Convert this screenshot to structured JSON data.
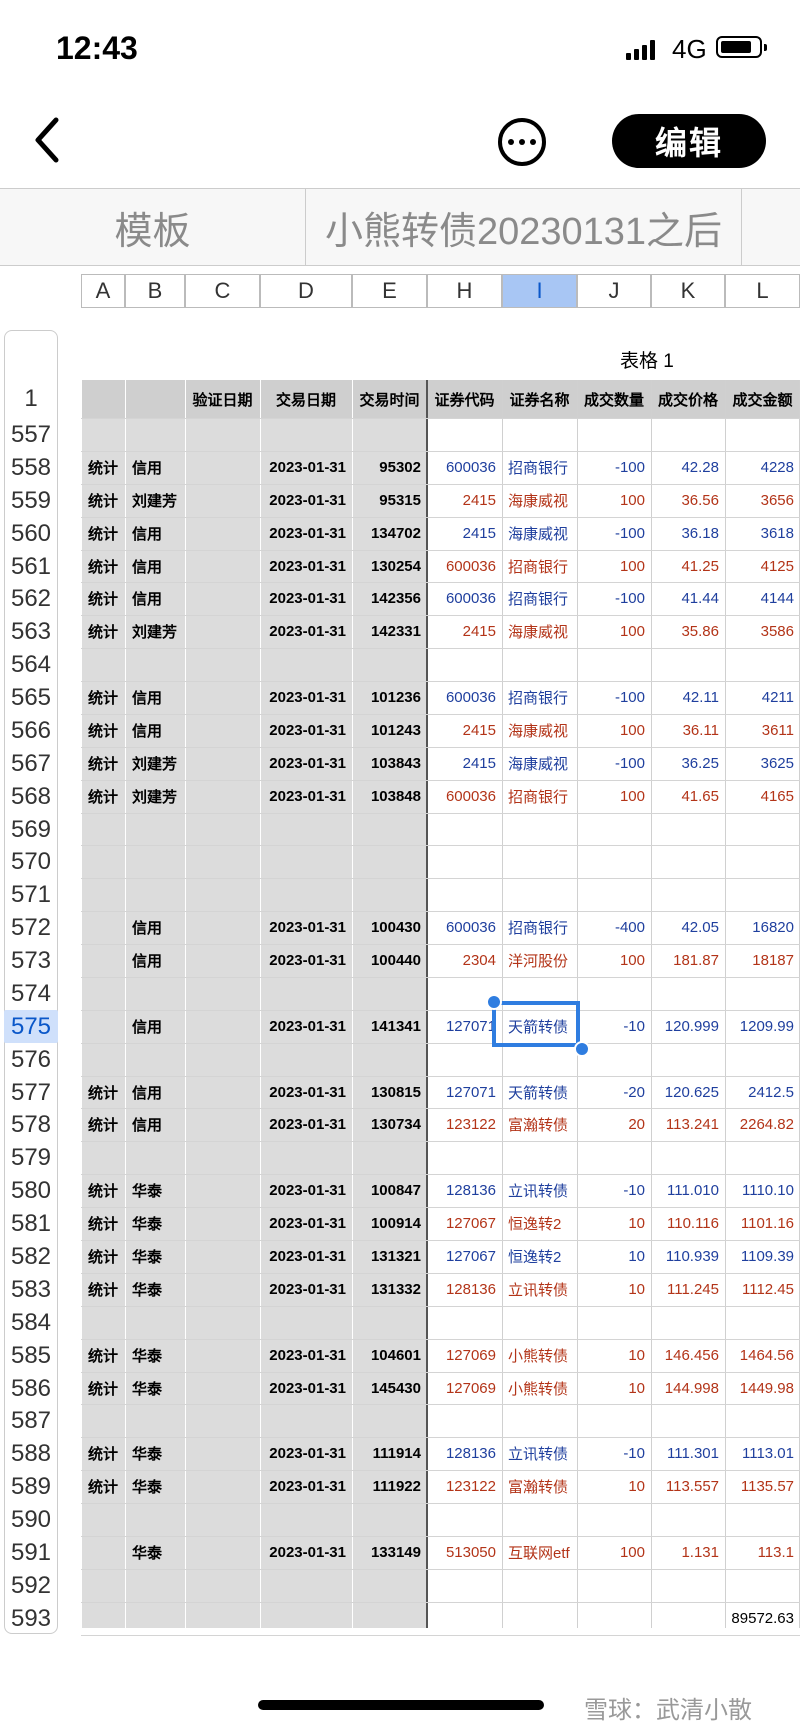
{
  "status_bar": {
    "time": "12:43",
    "network": "4G"
  },
  "toolbar": {
    "edit_label": "编辑"
  },
  "sheet_tabs": [
    {
      "label": "模板"
    },
    {
      "label": "小熊转债20230131之后"
    }
  ],
  "column_letters": [
    "A",
    "B",
    "C",
    "D",
    "E",
    "H",
    "I",
    "J",
    "K",
    "L"
  ],
  "selected_column": "I",
  "table_title": "表格 1",
  "header_row_number": "1",
  "headers": {
    "C": "验证日期",
    "D": "交易日期",
    "E": "交易时间",
    "H": "证券代码",
    "I": "证券名称",
    "J": "成交数量",
    "K": "成交价格",
    "L": "成交金额"
  },
  "rows": [
    {
      "n": "557"
    },
    {
      "n": "558",
      "a": "统计",
      "b": "信用",
      "d": "2023-01-31",
      "e": "95302",
      "h": "600036",
      "i": "招商银行",
      "j": "-100",
      "k": "42.28",
      "l": "4228",
      "color": "blue"
    },
    {
      "n": "559",
      "a": "统计",
      "b": "刘建芳",
      "d": "2023-01-31",
      "e": "95315",
      "h": "2415",
      "i": "海康威视",
      "j": "100",
      "k": "36.56",
      "l": "3656",
      "color": "red"
    },
    {
      "n": "560",
      "a": "统计",
      "b": "信用",
      "d": "2023-01-31",
      "e": "134702",
      "h": "2415",
      "i": "海康威视",
      "j": "-100",
      "k": "36.18",
      "l": "3618",
      "color": "blue"
    },
    {
      "n": "561",
      "a": "统计",
      "b": "信用",
      "d": "2023-01-31",
      "e": "130254",
      "h": "600036",
      "i": "招商银行",
      "j": "100",
      "k": "41.25",
      "l": "4125",
      "color": "red"
    },
    {
      "n": "562",
      "a": "统计",
      "b": "信用",
      "d": "2023-01-31",
      "e": "142356",
      "h": "600036",
      "i": "招商银行",
      "j": "-100",
      "k": "41.44",
      "l": "4144",
      "color": "blue"
    },
    {
      "n": "563",
      "a": "统计",
      "b": "刘建芳",
      "d": "2023-01-31",
      "e": "142331",
      "h": "2415",
      "i": "海康威视",
      "j": "100",
      "k": "35.86",
      "l": "3586",
      "color": "red"
    },
    {
      "n": "564"
    },
    {
      "n": "565",
      "a": "统计",
      "b": "信用",
      "d": "2023-01-31",
      "e": "101236",
      "h": "600036",
      "i": "招商银行",
      "j": "-100",
      "k": "42.11",
      "l": "4211",
      "color": "blue"
    },
    {
      "n": "566",
      "a": "统计",
      "b": "信用",
      "d": "2023-01-31",
      "e": "101243",
      "h": "2415",
      "i": "海康威视",
      "j": "100",
      "k": "36.11",
      "l": "3611",
      "color": "red"
    },
    {
      "n": "567",
      "a": "统计",
      "b": "刘建芳",
      "d": "2023-01-31",
      "e": "103843",
      "h": "2415",
      "i": "海康威视",
      "j": "-100",
      "k": "36.25",
      "l": "3625",
      "color": "blue"
    },
    {
      "n": "568",
      "a": "统计",
      "b": "刘建芳",
      "d": "2023-01-31",
      "e": "103848",
      "h": "600036",
      "i": "招商银行",
      "j": "100",
      "k": "41.65",
      "l": "4165",
      "color": "red"
    },
    {
      "n": "569"
    },
    {
      "n": "570"
    },
    {
      "n": "571"
    },
    {
      "n": "572",
      "b": "信用",
      "d": "2023-01-31",
      "e": "100430",
      "h": "600036",
      "i": "招商银行",
      "j": "-400",
      "k": "42.05",
      "l": "16820",
      "color": "blue"
    },
    {
      "n": "573",
      "b": "信用",
      "d": "2023-01-31",
      "e": "100440",
      "h": "2304",
      "i": "洋河股份",
      "j": "100",
      "k": "181.87",
      "l": "18187",
      "color": "red"
    },
    {
      "n": "574"
    },
    {
      "n": "575",
      "b": "信用",
      "d": "2023-01-31",
      "e": "141341",
      "h": "127071",
      "i": "天箭转债",
      "j": "-10",
      "k": "120.999",
      "l": "1209.99",
      "color": "blue",
      "selected": true
    },
    {
      "n": "576"
    },
    {
      "n": "577",
      "a": "统计",
      "b": "信用",
      "d": "2023-01-31",
      "e": "130815",
      "h": "127071",
      "i": "天箭转债",
      "j": "-20",
      "k": "120.625",
      "l": "2412.5",
      "color": "blue"
    },
    {
      "n": "578",
      "a": "统计",
      "b": "信用",
      "d": "2023-01-31",
      "e": "130734",
      "h": "123122",
      "i": "富瀚转债",
      "j": "20",
      "k": "113.241",
      "l": "2264.82",
      "color": "red"
    },
    {
      "n": "579"
    },
    {
      "n": "580",
      "a": "统计",
      "b": "华泰",
      "d": "2023-01-31",
      "e": "100847",
      "h": "128136",
      "i": "立讯转债",
      "j": "-10",
      "k": "111.010",
      "l": "1110.10",
      "color": "blue"
    },
    {
      "n": "581",
      "a": "统计",
      "b": "华泰",
      "d": "2023-01-31",
      "e": "100914",
      "h": "127067",
      "i": "恒逸转2",
      "j": "10",
      "k": "110.116",
      "l": "1101.16",
      "color": "red"
    },
    {
      "n": "582",
      "a": "统计",
      "b": "华泰",
      "d": "2023-01-31",
      "e": "131321",
      "h": "127067",
      "i": "恒逸转2",
      "j": "10",
      "k": "110.939",
      "l": "1109.39",
      "color": "blue"
    },
    {
      "n": "583",
      "a": "统计",
      "b": "华泰",
      "d": "2023-01-31",
      "e": "131332",
      "h": "128136",
      "i": "立讯转债",
      "j": "10",
      "k": "111.245",
      "l": "1112.45",
      "color": "red"
    },
    {
      "n": "584"
    },
    {
      "n": "585",
      "a": "统计",
      "b": "华泰",
      "d": "2023-01-31",
      "e": "104601",
      "h": "127069",
      "i": "小熊转债",
      "j": "10",
      "k": "146.456",
      "l": "1464.56",
      "color": "red"
    },
    {
      "n": "586",
      "a": "统计",
      "b": "华泰",
      "d": "2023-01-31",
      "e": "145430",
      "h": "127069",
      "i": "小熊转债",
      "j": "10",
      "k": "144.998",
      "l": "1449.98",
      "color": "red"
    },
    {
      "n": "587"
    },
    {
      "n": "588",
      "a": "统计",
      "b": "华泰",
      "d": "2023-01-31",
      "e": "111914",
      "h": "128136",
      "i": "立讯转债",
      "j": "-10",
      "k": "111.301",
      "l": "1113.01",
      "color": "blue"
    },
    {
      "n": "589",
      "a": "统计",
      "b": "华泰",
      "d": "2023-01-31",
      "e": "111922",
      "h": "123122",
      "i": "富瀚转债",
      "j": "10",
      "k": "113.557",
      "l": "1135.57",
      "color": "red"
    },
    {
      "n": "590"
    },
    {
      "n": "591",
      "b": "华泰",
      "d": "2023-01-31",
      "e": "133149",
      "h": "513050",
      "i": "互联网etf",
      "j": "100",
      "k": "1.131",
      "l": "113.1",
      "color": "red"
    },
    {
      "n": "592"
    },
    {
      "n": "593",
      "l": "89572.63",
      "color": "black"
    }
  ],
  "watermark": "雪球：武清小散",
  "colors": {
    "buy": "#b33418",
    "sell": "#1f3f9e",
    "selection": "#2f7de0"
  }
}
